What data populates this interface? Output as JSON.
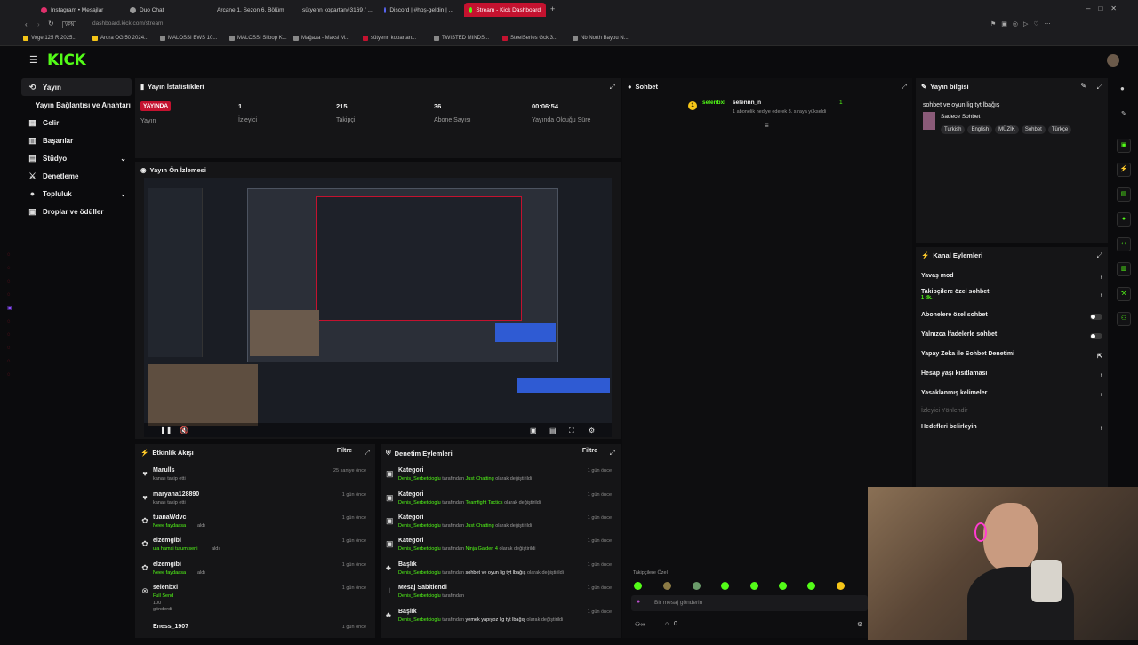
{
  "browser": {
    "tabs": [
      {
        "label": "Instagram • Mesajlar",
        "color": "#e1306c"
      },
      {
        "label": "Duo Chat",
        "color": "#9a9a9a"
      },
      {
        "label": "Arcane 1. Sezon 6. Bölüm",
        "color": "#c4122f"
      },
      {
        "label": "sütyenn kopartan#3169 / ...",
        "color": "#c4122f"
      },
      {
        "label": "Discord | #hoş-geldin | ...",
        "color": "#5865f2"
      },
      {
        "label": "Stream - Kick Dashboard",
        "color": "#53fc18"
      }
    ],
    "url": "dashboard.kick.com/stream",
    "bookmarks": [
      "Voge 125 R 2025...",
      "Arora OG 50 2024...",
      "MALOSSI BWS 10...",
      "MALOSSI Silbop K...",
      "Mağaza - Maksi M...",
      "sütyenn kopartan...",
      "TWISTED MINDS...",
      "SteelSeries Gck 3...",
      "Nb North Bayou N..."
    ]
  },
  "app": {
    "logo": "KICK"
  },
  "sidebar": {
    "items": [
      {
        "label": "Yayın",
        "icon": "broadcast-icon"
      },
      {
        "label": "Yayın Bağlantısı ve Anahtarı",
        "icon": ""
      },
      {
        "label": "Gelir",
        "icon": "revenue-icon"
      },
      {
        "label": "Başarılar",
        "icon": "achievements-icon"
      },
      {
        "label": "Stüdyo",
        "icon": "studio-icon"
      },
      {
        "label": "Denetleme",
        "icon": "moderation-icon"
      },
      {
        "label": "Topluluk",
        "icon": "community-icon"
      },
      {
        "label": "Droplar ve ödüller",
        "icon": "drops-icon"
      }
    ]
  },
  "stats": {
    "title": "Yayın İstatistikleri",
    "live_badge": "YAYINDA",
    "live_label": "Yayın",
    "viewers": "1",
    "viewers_label": "İzleyici",
    "followers": "215",
    "followers_label": "Takipçi",
    "subs": "36",
    "subs_label": "Abone Sayısı",
    "duration": "00:06:54",
    "duration_label": "Yayında Olduğu Süre"
  },
  "preview": {
    "title": "Yayın Ön İzlemesi"
  },
  "activity": {
    "title": "Etkinlik Akışı",
    "filter": "Filtre",
    "rows": [
      {
        "name": "Marulls",
        "sub": "kanalı takip etti",
        "time": "25 saniye önce",
        "green": false
      },
      {
        "name": "maryana128890",
        "sub": "kanalı takip etti",
        "time": "1 gün önce",
        "green": false
      },
      {
        "name": "tuanaWdvc",
        "sub": "Neee faydaasa",
        "sub2": "aldı",
        "time": "1 gün önce",
        "green": true
      },
      {
        "name": "elzemgibi",
        "sub": "ula hamsi tutum seni",
        "sub2": "aldı",
        "time": "1 gün önce",
        "green": true
      },
      {
        "name": "elzemgibi",
        "sub": "Neee faydaasa",
        "sub2": "aldı",
        "time": "1 gün önce",
        "green": true
      },
      {
        "name": "selenbxl",
        "sub": "Full Send",
        "sub2": "100 gönderdi",
        "time": "1 gün önce",
        "green": true
      },
      {
        "name": "Eness_1907",
        "sub": "",
        "time": "1 gün önce",
        "green": false
      }
    ]
  },
  "modlog": {
    "title": "Denetim Eylemleri",
    "filter": "Filtre",
    "rows": [
      {
        "name": "Kategori",
        "user": "Denis_Serbetcioglu",
        "mid": "tarafından",
        "val": "Just Chatting",
        "end": "olarak değiştirildi",
        "time": "1 gün önce"
      },
      {
        "name": "Kategori",
        "user": "Denis_Serbetcioglu",
        "mid": "tarafından",
        "val": "Teamfight Tactics",
        "end": "olarak değiştirildi",
        "time": "1 gün önce"
      },
      {
        "name": "Kategori",
        "user": "Denis_Serbetcioglu",
        "mid": "tarafından",
        "val": "Just Chatting",
        "end": "olarak değiştirildi",
        "time": "1 gün önce"
      },
      {
        "name": "Kategori",
        "user": "Denis_Serbetcioglu",
        "mid": "tarafından",
        "val": "Ninja Gaiden 4",
        "end": "olarak değiştirildi",
        "time": "1 gün önce"
      },
      {
        "name": "Başlık",
        "user": "Denis_Serbetcioglu",
        "mid": "tarafından",
        "val": "sohbet ve oyun lig tyt lbağış",
        "end": "olarak değiştirildi",
        "time": "1 gün önce"
      },
      {
        "name": "Mesaj Sabitlendi",
        "user": "Denis_Serbetcioglu",
        "mid": "tarafından",
        "val": "",
        "end": "",
        "time": "1 gün önce"
      },
      {
        "name": "Başlık",
        "user": "Denis_Serbetcioglu",
        "mid": "tarafından",
        "val": "yemek yapıyoz lig tyt lbağış",
        "end": "olarak değiştirildi",
        "time": "1 gün önce"
      }
    ]
  },
  "chat": {
    "title": "Sohbet",
    "sender": "selenbxl",
    "target": "selennn_n",
    "count": "1",
    "gift_text": "1 abonelik hediye ederek 3. sıraya yükseldi",
    "followers_only": "Takipçilere Özel",
    "placeholder": "Bir mesaj gönderin",
    "bottom_count": "0"
  },
  "info": {
    "title": "Yayın bilgisi",
    "stream_title": "sohbet ve oyun lig tyt lbağış",
    "category": "Sadece Sohbet",
    "tags": [
      "Turkish",
      "English",
      "MÜZİK",
      "Sohbet",
      "Türkçe"
    ]
  },
  "channel_actions": {
    "title": "Kanal Eylemleri",
    "rows": [
      {
        "label": "Yavaş mod",
        "ctl": "chevron"
      },
      {
        "label": "Takipçilere özel sohbet",
        "sub": "1 dk.",
        "ctl": "chevron"
      },
      {
        "label": "Abonelere özel sohbet",
        "ctl": "toggle"
      },
      {
        "label": "Yalnızca İfadelerle sohbet",
        "ctl": "toggle"
      },
      {
        "label": "Yapay Zeka ile Sohbet Denetimi",
        "ctl": "ext"
      },
      {
        "label": "Hesap yaşı kısıtlaması",
        "ctl": "chevron"
      },
      {
        "label": "Yasaklanmış kelimeler",
        "ctl": "chevron"
      },
      {
        "label": "İzleyici Yönlendir",
        "ctl": "none",
        "dim": true
      },
      {
        "label": "Hedefleri belirleyin",
        "ctl": "chevron"
      }
    ]
  },
  "colors": {
    "brand": "#53fc18",
    "live": "#c4122f",
    "panel": "#151517",
    "bg": "#0b0b0d"
  }
}
